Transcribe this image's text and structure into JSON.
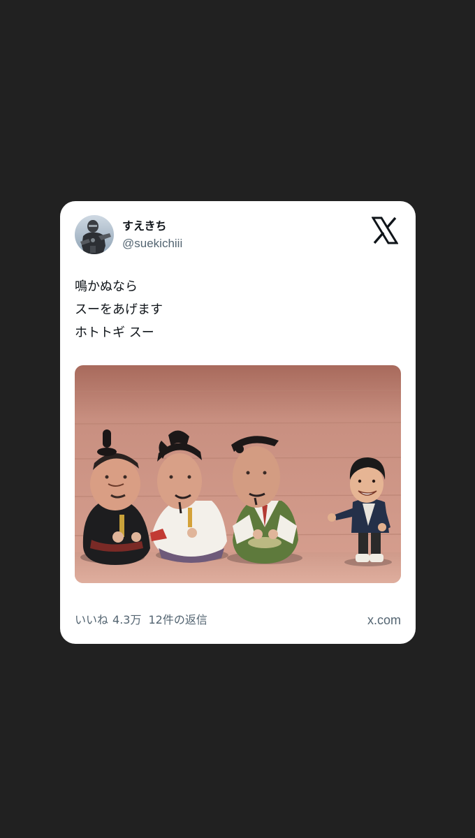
{
  "tweet": {
    "display_name": "すえきち",
    "handle": "@suekichiii",
    "text_lines": [
      "鳴かぬなら",
      "スーをあげます",
      "ホトトギ スー"
    ],
    "media_alt_icon": "photo-figurines",
    "likes_label": "いいね",
    "likes_count": "4.3万",
    "replies_label": "12件の返信",
    "domain": "x.com",
    "brand_icon": "x-logo-icon"
  },
  "colors": {
    "page_bg": "#212121",
    "card_bg": "#ffffff",
    "text_primary": "#0f1419",
    "text_secondary": "#536471"
  }
}
